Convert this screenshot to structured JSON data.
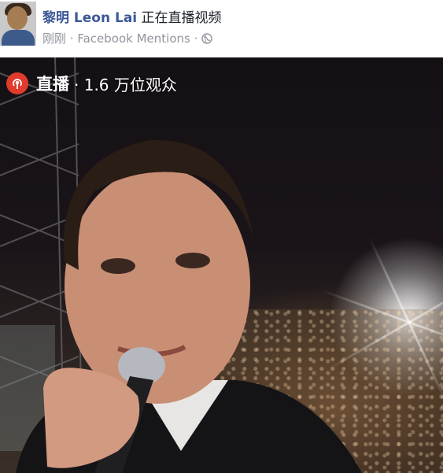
{
  "post": {
    "author": "黎明 Leon Lai",
    "action": "正在直播视频",
    "time": "刚刚",
    "separator": "·",
    "source": "Facebook Mentions",
    "privacy_icon": "globe-icon"
  },
  "live": {
    "label": "直播",
    "viewers": "· 1.6 万位观众",
    "icon": "live-broadcast-icon",
    "accent": "#e23b2d"
  },
  "colors": {
    "author_link": "#3b5998",
    "meta_text": "#90949c"
  }
}
